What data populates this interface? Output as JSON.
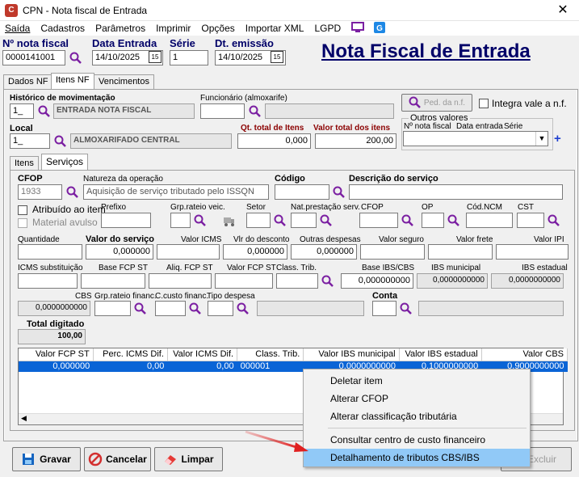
{
  "window": {
    "title": "CPN - Nota fiscal de Entrada",
    "close": "✕"
  },
  "menu": [
    "Saída",
    "Cadastros",
    "Parâmetros",
    "Imprimir",
    "Opções",
    "Importar XML",
    "LGPD"
  ],
  "header": {
    "nf_label": "Nº nota fiscal",
    "nf_value": "0000141001",
    "date_label": "Data Entrada",
    "date_value": "14/10/2025",
    "serie_label": "Série",
    "serie_value": "1",
    "emissao_label": "Dt. emissão",
    "emissao_value": "14/10/2025",
    "cal": "15",
    "page_title": "Nota Fiscal de Entrada"
  },
  "tabs": [
    "Dados NF",
    "Itens NF",
    "Vencimentos"
  ],
  "itens": {
    "hist_label": "Histórico de movimentação",
    "hist_code": "1_",
    "hist_desc": "ENTRADA NOTA FISCAL",
    "func_label": "Funcionário (almoxarife)",
    "ped_btn": "Ped. da n.f.",
    "integra": "Integra vale a n.f.",
    "local_label": "Local",
    "local_code": "1_",
    "local_desc": "ALMOXARIFADO CENTRAL",
    "qt_label": "Qt. total de Itens",
    "qt_value": "0,000",
    "vt_label": "Valor total dos itens",
    "vt_value": "200,00",
    "outros_label": "Outros valores",
    "outros_cols": [
      "Nº nota fiscal",
      "Data entrada",
      "Série"
    ]
  },
  "subtabs": [
    "Itens",
    "Serviços"
  ],
  "serv": {
    "cfop_label": "CFOP",
    "cfop_value": "1933",
    "nat_label": "Natureza da operação",
    "nat_value": "Aquisição de serviço tributado pelo ISSQN",
    "codigo_label": "Código",
    "desc_label": "Descrição do serviço",
    "atrib": "Atribuído ao item",
    "material": "Material avulso",
    "prefixo": "Prefixo",
    "grp_veic": "Grp.rateio veic.",
    "setor": "Setor",
    "nat_prest": "Nat.prestação serv.",
    "cfop2": "CFOP",
    "op": "OP",
    "ncm": "Cód.NCM",
    "cst": "CST",
    "quantidade": "Quantidade",
    "valor_servico": "Valor do serviço",
    "valor_servico_val": "0,000000",
    "valor_icms": "Valor ICMS",
    "vlr_desc": "Vlr do desconto",
    "vlr_desc_val": "0,000000",
    "outras": "Outras despesas",
    "outras_val": "0,000000",
    "seguro": "Valor seguro",
    "frete": "Valor frete",
    "ipi": "Valor IPI",
    "icms_sub": "ICMS substituição",
    "base_fcp": "Base FCP ST",
    "aliq_fcp": "Aliq. FCP ST",
    "valor_fcp": "Valor FCP ST",
    "class_trib": "Class. Trib.",
    "base_ibs": "Base IBS/CBS",
    "base_ibs_val": "0,000000000",
    "ibs_mun": "IBS municipal",
    "ibs_mun_val": "0,0000000000",
    "ibs_est": "IBS estadual",
    "ibs_est_val": "0,0000000000",
    "cbs": "CBS",
    "cbs_val": "0,0000000000",
    "grp_fin": "Grp.rateio financ.",
    "cc_fin": "C.custo financ.",
    "tipo_desp": "Tipo despesa",
    "conta": "Conta",
    "total_dig": "Total digitado",
    "total_dig_val": "100,00"
  },
  "grid": {
    "headers": [
      "Valor FCP ST",
      "Perc. ICMS Dif.",
      "Valor ICMS Dif.",
      "Class. Trib.",
      "Valor IBS municipal",
      "Valor IBS estadual",
      "Valor CBS"
    ],
    "row": [
      "0,000000",
      "0,00",
      "0,00",
      "000001",
      "0,0000000000",
      "0,1000000000",
      "0,9000000000"
    ]
  },
  "context_menu": [
    "Deletar item",
    "Alterar CFOP",
    "Alterar classificação tributária",
    "Consultar centro de custo financeiro",
    "Detalhamento de tributos CBS/IBS"
  ],
  "buttons": {
    "gravar": "Gravar",
    "cancelar": "Cancelar",
    "limpar": "Limpar",
    "excluir": "Excluir"
  },
  "colors": {
    "accent": "#000068",
    "selection": "#0a64d6",
    "menu_highlight": "#91c9f7",
    "arrow": "#e02020",
    "purple": "#7b1fa2"
  }
}
